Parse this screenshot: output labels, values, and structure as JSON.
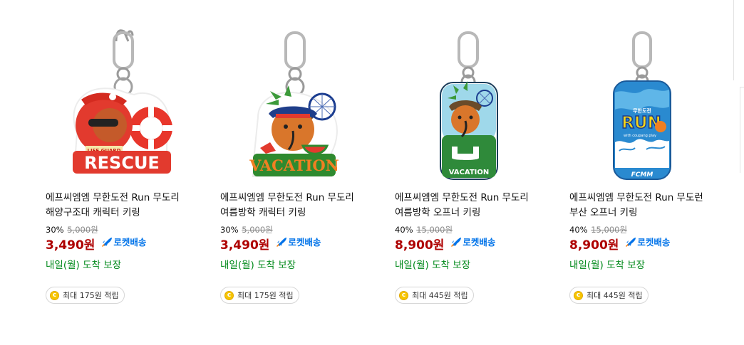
{
  "products": [
    {
      "title_line1": "에프씨엠엠 무한도전 Run 무도리",
      "title_line2": "해양구조대 캐릭터 키링",
      "discount": "30%",
      "original_price": "5,000원",
      "price": "3,490원",
      "delivery_badge": "로켓배송",
      "arrival": "내일(월) 도착 보장",
      "cashback": "최대 175원 적립",
      "image_texts": [
        "LIFE GUARD",
        "RESCUE"
      ]
    },
    {
      "title_line1": "에프씨엠엠 무한도전 Run 무도리",
      "title_line2": "여름방학 캐릭터 키링",
      "discount": "30%",
      "original_price": "5,000원",
      "price": "3,490원",
      "delivery_badge": "로켓배송",
      "arrival": "내일(월) 도착 보장",
      "cashback": "최대 175원 적립",
      "image_texts": [
        "VACATION"
      ]
    },
    {
      "title_line1": "에프씨엠엠 무한도전 Run 무도리",
      "title_line2": "여름방학 오프너 키링",
      "discount": "40%",
      "original_price": "15,000원",
      "price": "8,900원",
      "delivery_badge": "로켓배송",
      "arrival": "내일(월) 도착 보장",
      "cashback": "최대 445원 적립",
      "image_texts": [
        "VACATION"
      ]
    },
    {
      "title_line1": "에프씨엠엠 무한도전 Run 무도런",
      "title_line2": "부산 오프너 키링",
      "discount": "40%",
      "original_price": "15,000원",
      "price": "8,900원",
      "delivery_badge": "로켓배송",
      "arrival": "내일(월) 도착 보장",
      "cashback": "최대 445원 적립",
      "image_texts": [
        "무한도전",
        "RUN",
        "with coupang play",
        "FCMM"
      ]
    }
  ],
  "icons": {
    "rocket": "rocket-icon",
    "coin": "coin-icon",
    "coin_glyph": "c"
  },
  "colors": {
    "price": "#ae0000",
    "rocket": "#0073e9",
    "arrival": "#00891a",
    "coin": "#f7c500"
  }
}
